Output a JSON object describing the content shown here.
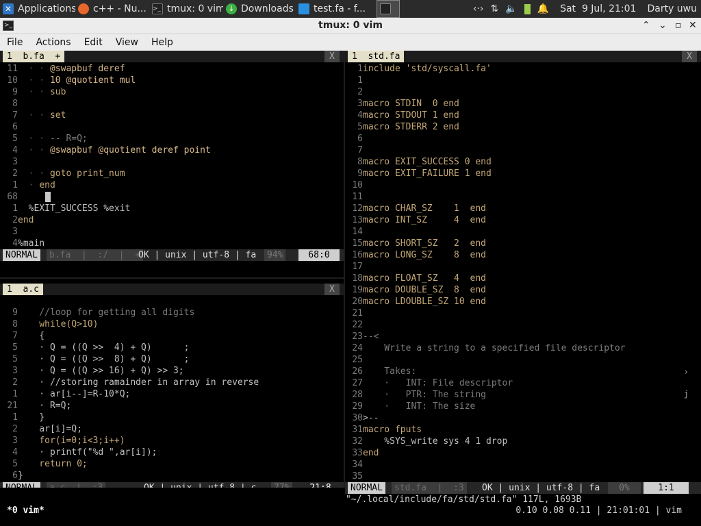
{
  "taskbar": {
    "tasks": [
      {
        "label": "Applications",
        "icon": "xfce-logo-icon",
        "color": "#2d77c4"
      },
      {
        "label": "c++ - Nu...",
        "icon": "firefox-icon",
        "color": "#e8672b"
      },
      {
        "label": "tmux: 0 vim",
        "icon": "terminal-icon",
        "color": "#333333"
      },
      {
        "label": "Downloads",
        "icon": "download-icon",
        "color": "#3cb043"
      },
      {
        "label": "test.fa - f...",
        "icon": "vscode-icon",
        "color": "#2b8fe0"
      },
      {
        "label": "",
        "icon": "terminal-icon",
        "color": "#333333"
      }
    ],
    "tray": {
      "network_icon": "network-icon",
      "transfer_icon": "transfer-icon",
      "volume_icon": "volume-icon",
      "battery_icon": "battery-icon",
      "bell_icon": "bell-icon",
      "clock": "Sat  9 Jul, 21:01",
      "user": "Darty uwu"
    }
  },
  "window": {
    "title": "tmux: 0 vim",
    "menu": [
      "File",
      "Actions",
      "Edit",
      "View",
      "Help"
    ]
  },
  "panes": {
    "bfa": {
      "tab": "1  b.fa  +",
      "tab_close": "X",
      "lines": [
        {
          "n": "11",
          "indent": "  · · ",
          "code": "@swapbuf deref"
        },
        {
          "n": "10",
          "indent": "  · · ",
          "code": "10 @quotient mul"
        },
        {
          "n": "9",
          "indent": "  · · ",
          "code": "sub"
        },
        {
          "n": "8",
          "indent": "",
          "code": ""
        },
        {
          "n": "7",
          "indent": "  · · ",
          "code": "set"
        },
        {
          "n": "6",
          "indent": "",
          "code": ""
        },
        {
          "n": "5",
          "indent": "  · · ",
          "code": "-- R=Q;"
        },
        {
          "n": "4",
          "indent": "  · · ",
          "code": "@swapbuf @quotient deref point"
        },
        {
          "n": "3",
          "indent": "",
          "code": ""
        },
        {
          "n": "2",
          "indent": "  · · ",
          "code": "goto print_num"
        },
        {
          "n": "1",
          "indent": "  · ",
          "code": "end"
        },
        {
          "n": "68",
          "indent": "",
          "code": ""
        },
        {
          "n": "1",
          "indent": "  ",
          "code": "%EXIT_SUCCESS %exit"
        },
        {
          "n": "2",
          "indent": "",
          "code": "end"
        },
        {
          "n": "3",
          "indent": "",
          "code": ""
        },
        {
          "n": "4",
          "indent": "",
          "code": "%main"
        }
      ],
      "status": {
        "mode": "NORMAL",
        "file": "b.fa  |  :/  |  +",
        "info": "OK | unix | utf-8 | fa",
        "pct": "94%",
        "pos": "68:0"
      }
    },
    "ac": {
      "tab": "1  a.c",
      "tab_close": "X",
      "lines": [
        {
          "n": "9",
          "code": "    //loop for getting all digits"
        },
        {
          "n": "8",
          "code": "    while(Q>10)"
        },
        {
          "n": "7",
          "code": "    {"
        },
        {
          "n": "5",
          "code": "    · Q = ((Q >>  4) + Q)      ;"
        },
        {
          "n": "5",
          "code": "    · Q = ((Q >>  8) + Q)      ;"
        },
        {
          "n": "3",
          "code": "    · Q = ((Q >> 16) + Q) >> 3;"
        },
        {
          "n": "2",
          "code": "    · //storing ramainder in array in reverse"
        },
        {
          "n": "1",
          "code": "    · ar[i--]=R-10*Q;"
        },
        {
          "n": "21",
          "code": "    · R=Q;"
        },
        {
          "n": "1",
          "code": "    }"
        },
        {
          "n": "2",
          "code": "    ar[i]=Q;"
        },
        {
          "n": "3",
          "code": "    for(i=0;i<3;i++)"
        },
        {
          "n": "4",
          "code": "    · printf(\"%d \",ar[i]);"
        },
        {
          "n": "5",
          "code": "    return 0;"
        },
        {
          "n": "6",
          "code": "}"
        }
      ],
      "status": {
        "mode": "NORMAL",
        "file": "a.c  |  :3",
        "info": "OK | unix | utf-8 | c",
        "pct": "77%",
        "pos": "21:8"
      }
    },
    "stdfa": {
      "tab": "1  std.fa",
      "tab_close": "X",
      "lines": [
        {
          "n": "1",
          "code": "include 'std/syscall.fa'"
        },
        {
          "n": "1",
          "code": ""
        },
        {
          "n": "2",
          "code": ""
        },
        {
          "n": "3",
          "code": "macro STDIN  0 end"
        },
        {
          "n": "4",
          "code": "macro STDOUT 1 end"
        },
        {
          "n": "5",
          "code": "macro STDERR 2 end"
        },
        {
          "n": "6",
          "code": ""
        },
        {
          "n": "7",
          "code": ""
        },
        {
          "n": "8",
          "code": "macro EXIT_SUCCESS 0 end"
        },
        {
          "n": "9",
          "code": "macro EXIT_FAILURE 1 end"
        },
        {
          "n": "10",
          "code": ""
        },
        {
          "n": "11",
          "code": ""
        },
        {
          "n": "12",
          "code": "macro CHAR_SZ    1  end"
        },
        {
          "n": "13",
          "code": "macro INT_SZ     4  end"
        },
        {
          "n": "14",
          "code": ""
        },
        {
          "n": "15",
          "code": "macro SHORT_SZ   2  end"
        },
        {
          "n": "16",
          "code": "macro LONG_SZ    8  end"
        },
        {
          "n": "17",
          "code": ""
        },
        {
          "n": "18",
          "code": "macro FLOAT_SZ   4  end"
        },
        {
          "n": "19",
          "code": "macro DOUBLE_SZ  8  end"
        },
        {
          "n": "20",
          "code": "macro LDOUBLE_SZ 10 end"
        },
        {
          "n": "21",
          "code": ""
        },
        {
          "n": "22",
          "code": ""
        },
        {
          "n": "23",
          "code": "--<"
        },
        {
          "n": "24",
          "code": "    Write a string to a specified file descriptor"
        },
        {
          "n": "25",
          "code": ""
        },
        {
          "n": "26",
          "code": "    Takes:"
        },
        {
          "n": "27",
          "code": "    ·   INT: File descriptor"
        },
        {
          "n": "28",
          "code": "    ·   PTR: The string"
        },
        {
          "n": "29",
          "code": "    ·   INT: The size"
        },
        {
          "n": "30",
          "code": ">--"
        },
        {
          "n": "31",
          "code": "macro fputs"
        },
        {
          "n": "32",
          "code": "    %SYS_write sys 4 1 drop"
        },
        {
          "n": "33",
          "code": "end"
        },
        {
          "n": "34",
          "code": ""
        },
        {
          "n": "35",
          "code": ""
        }
      ],
      "status": {
        "mode": "NORMAL",
        "file": "std.fa  |  :3",
        "info": "OK | unix | utf-8 | fa",
        "pct": "0%",
        "pos": "1:1"
      }
    }
  },
  "cmdline": "\"~/.local/include/fa/std/std.fa\" 117L, 1693B",
  "tmux": {
    "window": "*0 vim*",
    "status_right": "0.10 0.08 0.11 | 21:01:01 | vim"
  }
}
